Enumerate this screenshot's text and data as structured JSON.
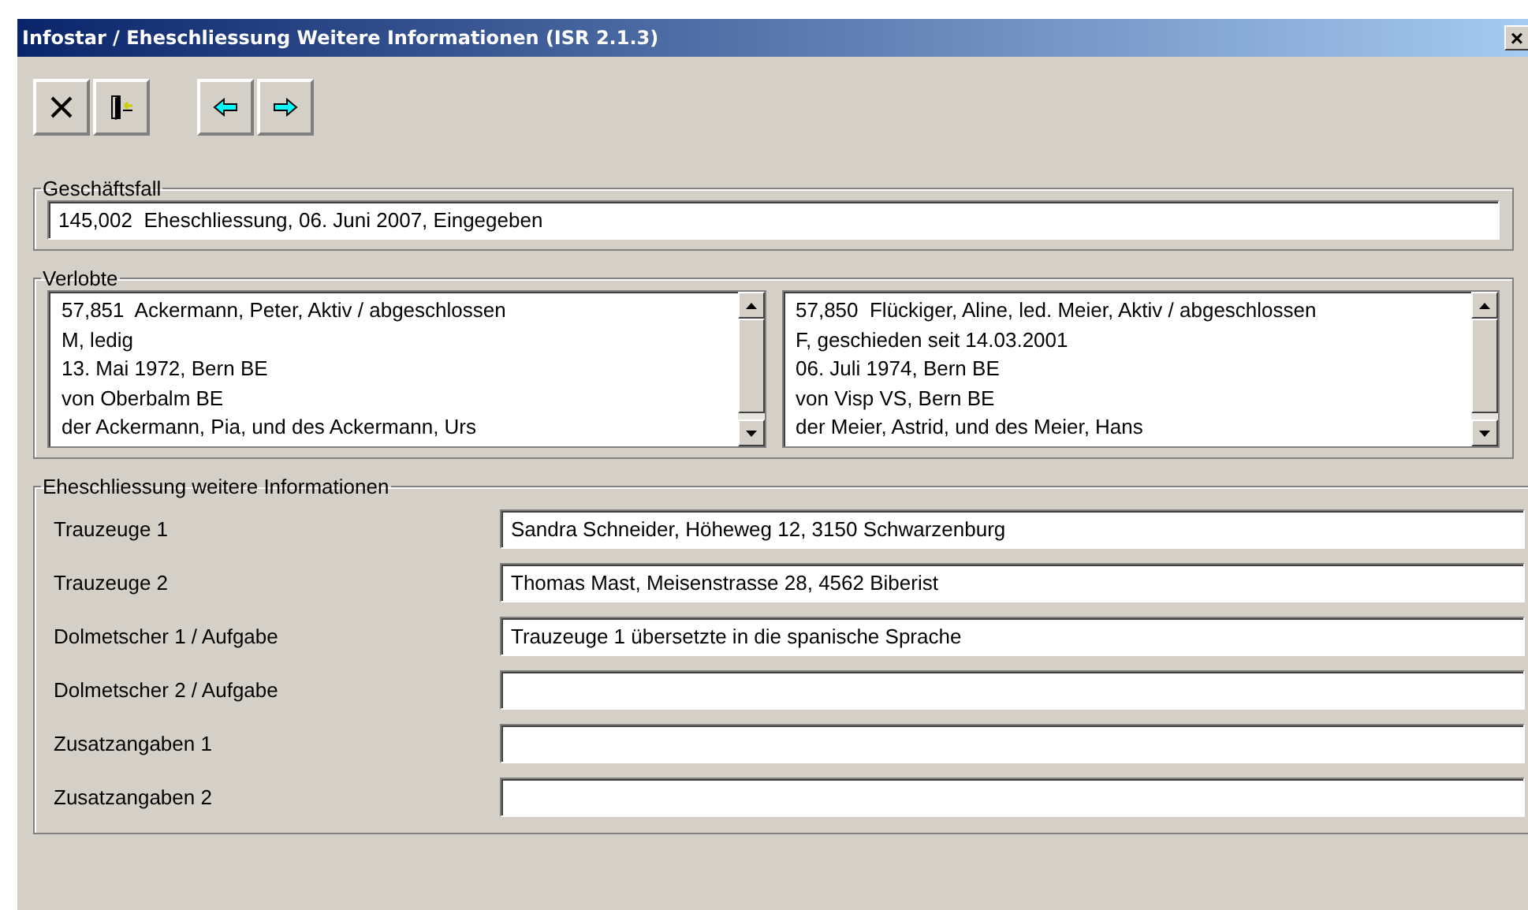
{
  "window": {
    "title": "Infostar / Eheschliessung Weitere Informationen (ISR 2.1.3)",
    "close": "×"
  },
  "toolbar": [
    {
      "kind": "cancel"
    },
    {
      "kind": "exit"
    },
    {
      "kind": "back"
    },
    {
      "kind": "forward"
    }
  ],
  "geschaeftsfall": {
    "legend": "Geschäftsfall",
    "value": "145,002  Eheschliessung, 06. Juni 2007, Eingegeben"
  },
  "verlobte": {
    "legend": "Verlobte",
    "persons": [
      {
        "lines": [
          "57,851  Ackermann, Peter, Aktiv / abgeschlossen",
          "M, ledig",
          "13. Mai 1972, Bern BE",
          "von Oberbalm BE",
          "der Ackermann, Pia, und des Ackermann, Urs"
        ]
      },
      {
        "lines": [
          "57,850  Flückiger, Aline, led. Meier, Aktiv / abgeschlossen",
          "F, geschieden seit 14.03.2001",
          "06. Juli 1974, Bern BE",
          "von Visp VS, Bern BE",
          "der Meier, Astrid, und des Meier, Hans"
        ]
      }
    ]
  },
  "weitere": {
    "legend": "Eheschliessung weitere Informationen",
    "fields": [
      {
        "label": "Trauzeuge 1",
        "value": "Sandra Schneider, Höheweg 12, 3150 Schwarzenburg"
      },
      {
        "label": "Trauzeuge 2",
        "value": "Thomas Mast, Meisenstrasse 28, 4562 Biberist"
      },
      {
        "label": "Dolmetscher 1 / Aufgabe",
        "value": "Trauzeuge 1 übersetzte in die spanische Sprache"
      },
      {
        "label": "Dolmetscher 2 / Aufgabe"
      },
      {
        "label": "Zusatzangaben 1"
      },
      {
        "label": "Zusatzangaben 2"
      }
    ]
  }
}
